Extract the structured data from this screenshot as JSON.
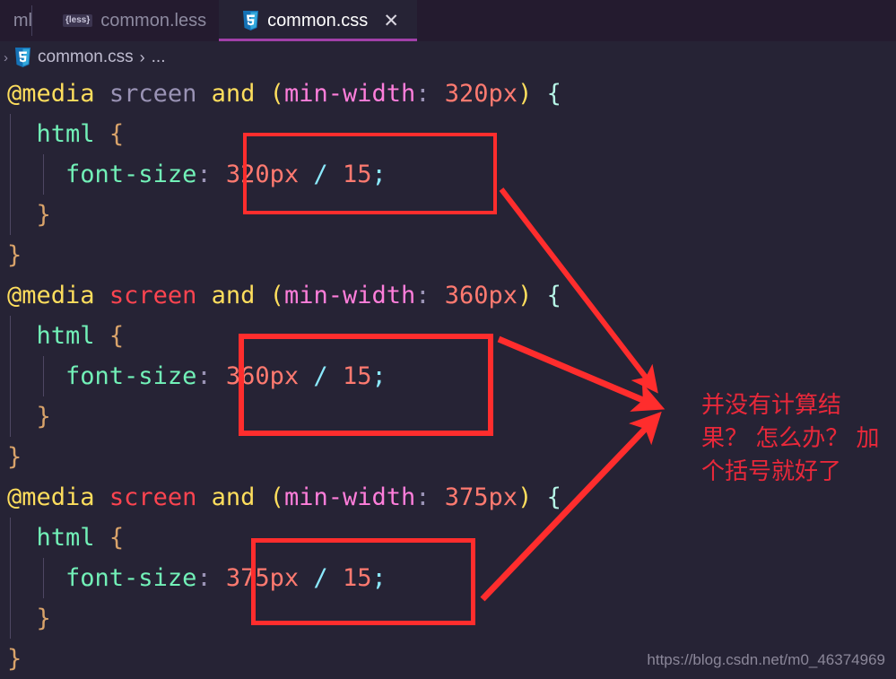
{
  "window": {
    "background_color": "#262335",
    "tabbar_color": "#241b2f"
  },
  "tabs": [
    {
      "label": "ml",
      "icon": "file-icon",
      "partial": true,
      "active": false
    },
    {
      "label": "common.less",
      "icon": "less-icon",
      "badge": "{less}",
      "active": false
    },
    {
      "label": "common.css",
      "icon": "css3-icon",
      "active": true,
      "close": "✕",
      "accent": "#a13fa8"
    }
  ],
  "breadcrumb": {
    "expand_chevron": "›",
    "icon": "css3-icon",
    "file": "common.css",
    "separator": "›",
    "ellipsis": "..."
  },
  "code": {
    "lines": [
      {
        "indent": 0,
        "tokens": [
          {
            "t": "@media",
            "c": "t-at"
          },
          {
            "t": " ",
            "c": ""
          },
          {
            "t": "srceen",
            "c": "t-unknown"
          },
          {
            "t": " ",
            "c": ""
          },
          {
            "t": "and",
            "c": "t-and"
          },
          {
            "t": " ",
            "c": ""
          },
          {
            "t": "(",
            "c": "t-paren"
          },
          {
            "t": "min-width",
            "c": "t-feature"
          },
          {
            "t": ":",
            "c": "t-colon"
          },
          {
            "t": " ",
            "c": ""
          },
          {
            "t": "320px",
            "c": "t-value"
          },
          {
            "t": ")",
            "c": "t-paren"
          },
          {
            "t": " ",
            "c": ""
          },
          {
            "t": "{",
            "c": "t-brace2"
          }
        ]
      },
      {
        "indent": 1,
        "guides": [
          1
        ],
        "tokens": [
          {
            "t": "  ",
            "c": ""
          },
          {
            "t": "html",
            "c": "t-sel"
          },
          {
            "t": " ",
            "c": ""
          },
          {
            "t": "{",
            "c": "t-brace"
          }
        ]
      },
      {
        "indent": 2,
        "guides": [
          1,
          2
        ],
        "tokens": [
          {
            "t": "    ",
            "c": ""
          },
          {
            "t": "font-size",
            "c": "t-prop"
          },
          {
            "t": ":",
            "c": "t-colon"
          },
          {
            "t": " ",
            "c": ""
          },
          {
            "t": "320px",
            "c": "t-value"
          },
          {
            "t": " ",
            "c": ""
          },
          {
            "t": "/",
            "c": "t-slash"
          },
          {
            "t": " ",
            "c": ""
          },
          {
            "t": "15",
            "c": "t-value"
          },
          {
            "t": ";",
            "c": "t-semi"
          }
        ]
      },
      {
        "indent": 1,
        "guides": [
          1
        ],
        "tokens": [
          {
            "t": "  ",
            "c": ""
          },
          {
            "t": "}",
            "c": "t-brace"
          }
        ]
      },
      {
        "indent": 0,
        "tokens": [
          {
            "t": "}",
            "c": "t-brace"
          }
        ]
      },
      {
        "indent": 0,
        "tokens": [
          {
            "t": "@media",
            "c": "t-at"
          },
          {
            "t": " ",
            "c": ""
          },
          {
            "t": "screen",
            "c": "t-screen"
          },
          {
            "t": " ",
            "c": ""
          },
          {
            "t": "and",
            "c": "t-and"
          },
          {
            "t": " ",
            "c": ""
          },
          {
            "t": "(",
            "c": "t-paren"
          },
          {
            "t": "min-width",
            "c": "t-feature"
          },
          {
            "t": ":",
            "c": "t-colon"
          },
          {
            "t": " ",
            "c": ""
          },
          {
            "t": "360px",
            "c": "t-value"
          },
          {
            "t": ")",
            "c": "t-paren"
          },
          {
            "t": " ",
            "c": ""
          },
          {
            "t": "{",
            "c": "t-brace2"
          }
        ]
      },
      {
        "indent": 1,
        "guides": [
          1
        ],
        "tokens": [
          {
            "t": "  ",
            "c": ""
          },
          {
            "t": "html",
            "c": "t-sel"
          },
          {
            "t": " ",
            "c": ""
          },
          {
            "t": "{",
            "c": "t-brace"
          }
        ]
      },
      {
        "indent": 2,
        "guides": [
          1,
          2
        ],
        "tokens": [
          {
            "t": "    ",
            "c": ""
          },
          {
            "t": "font-size",
            "c": "t-prop"
          },
          {
            "t": ":",
            "c": "t-colon"
          },
          {
            "t": " ",
            "c": ""
          },
          {
            "t": "360px",
            "c": "t-value"
          },
          {
            "t": " ",
            "c": ""
          },
          {
            "t": "/",
            "c": "t-slash"
          },
          {
            "t": " ",
            "c": ""
          },
          {
            "t": "15",
            "c": "t-value"
          },
          {
            "t": ";",
            "c": "t-semi"
          }
        ]
      },
      {
        "indent": 1,
        "guides": [
          1
        ],
        "tokens": [
          {
            "t": "  ",
            "c": ""
          },
          {
            "t": "}",
            "c": "t-brace"
          }
        ]
      },
      {
        "indent": 0,
        "tokens": [
          {
            "t": "}",
            "c": "t-brace"
          }
        ]
      },
      {
        "indent": 0,
        "tokens": [
          {
            "t": "@media",
            "c": "t-at"
          },
          {
            "t": " ",
            "c": ""
          },
          {
            "t": "screen",
            "c": "t-screen"
          },
          {
            "t": " ",
            "c": ""
          },
          {
            "t": "and",
            "c": "t-and"
          },
          {
            "t": " ",
            "c": ""
          },
          {
            "t": "(",
            "c": "t-paren"
          },
          {
            "t": "min-width",
            "c": "t-feature"
          },
          {
            "t": ":",
            "c": "t-colon"
          },
          {
            "t": " ",
            "c": ""
          },
          {
            "t": "375px",
            "c": "t-value"
          },
          {
            "t": ")",
            "c": "t-paren"
          },
          {
            "t": " ",
            "c": ""
          },
          {
            "t": "{",
            "c": "t-brace2"
          }
        ]
      },
      {
        "indent": 1,
        "guides": [
          1
        ],
        "tokens": [
          {
            "t": "  ",
            "c": ""
          },
          {
            "t": "html",
            "c": "t-sel"
          },
          {
            "t": " ",
            "c": ""
          },
          {
            "t": "{",
            "c": "t-brace"
          }
        ]
      },
      {
        "indent": 2,
        "guides": [
          1,
          2
        ],
        "tokens": [
          {
            "t": "    ",
            "c": ""
          },
          {
            "t": "font-size",
            "c": "t-prop"
          },
          {
            "t": ":",
            "c": "t-colon"
          },
          {
            "t": " ",
            "c": ""
          },
          {
            "t": "375px",
            "c": "t-value"
          },
          {
            "t": " ",
            "c": ""
          },
          {
            "t": "/",
            "c": "t-slash"
          },
          {
            "t": " ",
            "c": ""
          },
          {
            "t": "15",
            "c": "t-value"
          },
          {
            "t": ";",
            "c": "t-semi"
          }
        ]
      },
      {
        "indent": 1,
        "guides": [
          1
        ],
        "tokens": [
          {
            "t": "  ",
            "c": ""
          },
          {
            "t": "}",
            "c": "t-brace"
          }
        ]
      },
      {
        "indent": 0,
        "tokens": [
          {
            "t": "}",
            "c": "t-brace"
          }
        ]
      }
    ]
  },
  "annotations": {
    "color": "#ff2d2d",
    "note_color": "#e8283a",
    "note_lines": [
      "并没有计算结",
      "果？ 怎么办？ 加",
      "个括号就好了"
    ],
    "boxes": [
      {
        "name": "highlight-box-320",
        "label": "320px / 15;"
      },
      {
        "name": "highlight-box-360",
        "label": "360px / 15;"
      },
      {
        "name": "highlight-box-375",
        "label": "375px / 15;"
      }
    ]
  },
  "watermark": "https://blog.csdn.net/m0_46374969"
}
